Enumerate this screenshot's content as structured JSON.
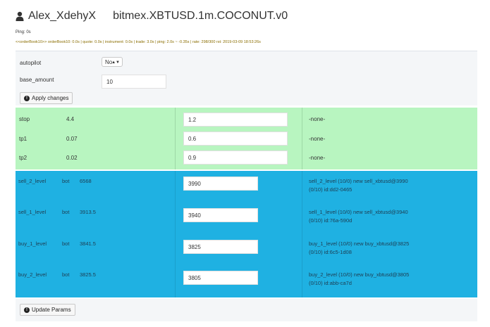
{
  "header": {
    "user": "Alex_XdehyX",
    "bot_title": "bitmex.XBTUSD.1m.COCONUT.v0"
  },
  "ping": "Ping: 0s",
  "status_line": "<<orderBook10>> orderBook10: 0.0s | quote: 0.0s | instrument: 0.0s | trade: 3.0s | ping: 2.0s ~ -0.35s | rate: 298/300 rst: 2019-03-09 18:53:26s",
  "settings": {
    "autopilot_label": "autopilot",
    "autopilot_value": "No",
    "base_amount_label": "base_amount",
    "base_amount_value": "10",
    "apply_button": "Apply changes"
  },
  "params": [
    {
      "name": "stop",
      "current": "4.4",
      "input": "1.2",
      "status": "-none-"
    },
    {
      "name": "tp1",
      "current": "0.07",
      "input": "0.6",
      "status": "-none-"
    },
    {
      "name": "tp2",
      "current": "0.02",
      "input": "0.9",
      "status": "-none-"
    }
  ],
  "levels": [
    {
      "name": "sell_2_level",
      "source": "bot",
      "current": "6568",
      "input": "3990",
      "status_line1": "sell_2_level (10/0) new sell_xbtusd@3990",
      "status_line2": "(0/10) id:dd2-0465"
    },
    {
      "name": "sell_1_level",
      "source": "bot",
      "current": "3913.5",
      "input": "3940",
      "status_line1": "sell_1_level (10/0) new sell_xbtusd@3940",
      "status_line2": "(0/10) id:76a-590d"
    },
    {
      "name": "buy_1_level",
      "source": "bot",
      "current": "3841.5",
      "input": "3825",
      "status_line1": "buy_1_level (10/0) new buy_xbtusd@3825",
      "status_line2": "(0/10) id:6c5-1d08"
    },
    {
      "name": "buy_2_level",
      "source": "bot",
      "current": "3825.5",
      "input": "3805",
      "status_line1": "buy_2_level (10/0) new buy_xbtusd@3805",
      "status_line2": "(0/10) id:abb-ca7d"
    }
  ],
  "update_button": "Update Params",
  "colors": {
    "params_bg": "#b8f5c0",
    "levels_bg": "#1fb1e2",
    "settings_bg": "#f4f6f8"
  }
}
